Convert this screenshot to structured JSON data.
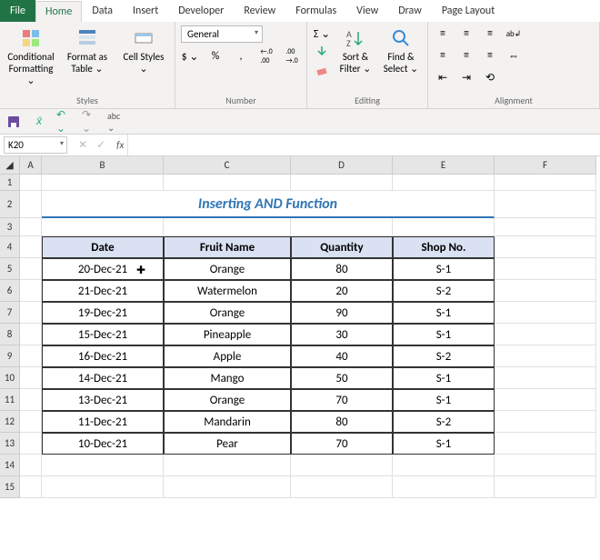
{
  "tabs": [
    "File",
    "Home",
    "Data",
    "Insert",
    "Developer",
    "Review",
    "Formulas",
    "View",
    "Draw",
    "Page Layout"
  ],
  "active_tab": "Home",
  "ribbon": {
    "styles": {
      "conditional": "Conditional Formatting ⌄",
      "format_as": "Format as Table ⌄",
      "cell_styles": "Cell Styles ⌄",
      "label": "Styles"
    },
    "number": {
      "format": "General",
      "label": "Number",
      "currency": "$ ⌄",
      "percent": "%",
      "comma": ",",
      "inc": ".0→.00",
      "dec": ".00→.0"
    },
    "editing": {
      "sort": "Sort & Filter ⌄",
      "find": "Find & Select ⌄",
      "label": "Editing"
    },
    "alignment": {
      "label": "Alignment"
    }
  },
  "namebox": "K20",
  "fx": "fx",
  "columns": [
    "A",
    "B",
    "C",
    "D",
    "E",
    "F"
  ],
  "row_nums": [
    "1",
    "2",
    "3",
    "4",
    "5",
    "6",
    "7",
    "8",
    "9",
    "10",
    "11",
    "12",
    "13",
    "14",
    "15"
  ],
  "title": "Inserting AND Function",
  "h": {
    "date": "Date",
    "fruit": "Fruit Name",
    "qty": "Quantity",
    "shop": "Shop No."
  },
  "r": [
    {
      "d": "20-Dec-21",
      "f": "Orange",
      "q": "80",
      "s": "S-1"
    },
    {
      "d": "21-Dec-21",
      "f": "Watermelon",
      "q": "20",
      "s": "S-2"
    },
    {
      "d": "19-Dec-21",
      "f": "Orange",
      "q": "90",
      "s": "S-1"
    },
    {
      "d": "15-Dec-21",
      "f": "Pineapple",
      "q": "30",
      "s": "S-1"
    },
    {
      "d": "16-Dec-21",
      "f": "Apple",
      "q": "40",
      "s": "S-2"
    },
    {
      "d": "14-Dec-21",
      "f": "Mango",
      "q": "50",
      "s": "S-1"
    },
    {
      "d": "13-Dec-21",
      "f": "Orange",
      "q": "70",
      "s": "S-1"
    },
    {
      "d": "11-Dec-21",
      "f": "Mandarin",
      "q": "80",
      "s": "S-2"
    },
    {
      "d": "10-Dec-21",
      "f": "Pear",
      "q": "70",
      "s": "S-1"
    }
  ]
}
